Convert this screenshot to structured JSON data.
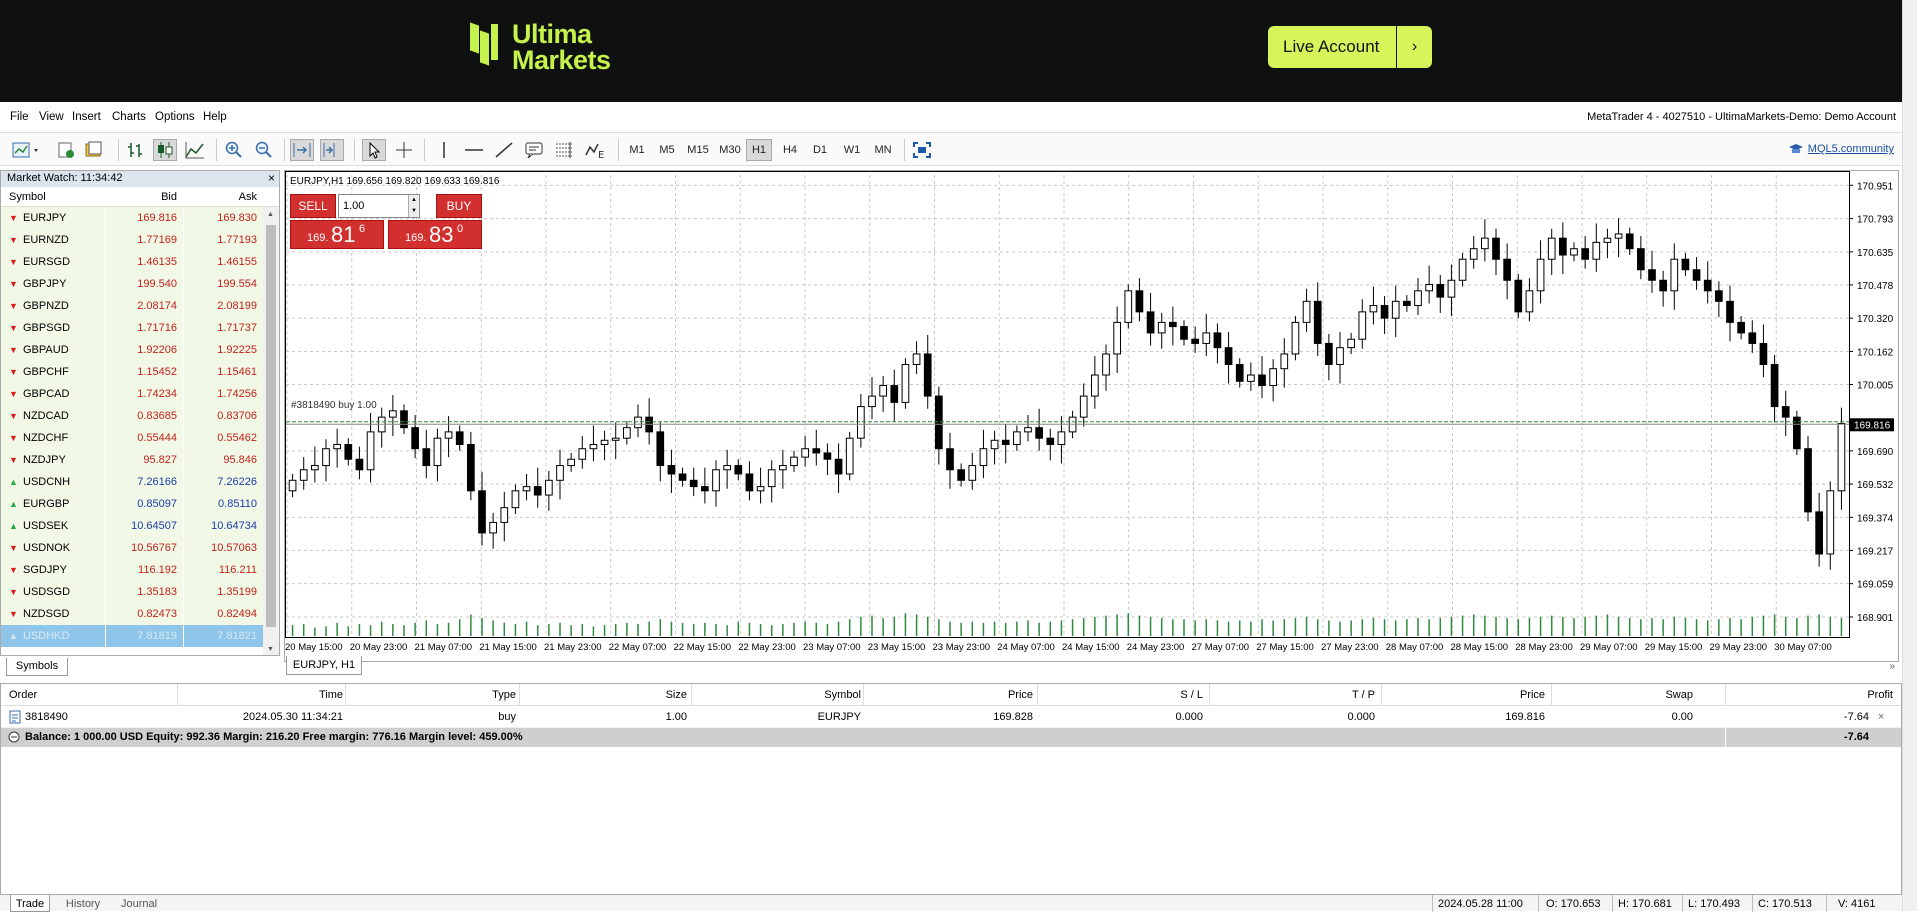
{
  "banner": {
    "logo_line1": "Ultima",
    "logo_line2": "Markets",
    "live_button": "Live Account",
    "live_arrow": "›",
    "colors": {
      "background": "#0e110f",
      "accent": "#c5f24c"
    }
  },
  "menu": {
    "items": [
      "File",
      "View",
      "Insert",
      "Charts",
      "Options",
      "Help"
    ],
    "window_title": "MetaTrader 4 - 4027510 - UltimaMarkets-Demo: Demo Account"
  },
  "toolbar": {
    "timeframes": [
      "M1",
      "M5",
      "M15",
      "M30",
      "H1",
      "H4",
      "D1",
      "W1",
      "MN"
    ],
    "selected_timeframe": "H1",
    "mql_link": "MQL5.community"
  },
  "market_watch": {
    "title": "Market Watch: 11:34:42",
    "close": "×",
    "columns": {
      "symbol": "Symbol",
      "bid": "Bid",
      "ask": "Ask"
    },
    "rows": [
      {
        "symbol": "EURJPY",
        "bid": "169.816",
        "ask": "169.830",
        "dir": "down"
      },
      {
        "symbol": "EURNZD",
        "bid": "1.77169",
        "ask": "1.77193",
        "dir": "down"
      },
      {
        "symbol": "EURSGD",
        "bid": "1.46135",
        "ask": "1.46155",
        "dir": "down"
      },
      {
        "symbol": "GBPJPY",
        "bid": "199.540",
        "ask": "199.554",
        "dir": "down"
      },
      {
        "symbol": "GBPNZD",
        "bid": "2.08174",
        "ask": "2.08199",
        "dir": "down"
      },
      {
        "symbol": "GBPSGD",
        "bid": "1.71716",
        "ask": "1.71737",
        "dir": "down"
      },
      {
        "symbol": "GBPAUD",
        "bid": "1.92206",
        "ask": "1.92225",
        "dir": "down"
      },
      {
        "symbol": "GBPCHF",
        "bid": "1.15452",
        "ask": "1.15461",
        "dir": "down"
      },
      {
        "symbol": "GBPCAD",
        "bid": "1.74234",
        "ask": "1.74256",
        "dir": "down"
      },
      {
        "symbol": "NZDCAD",
        "bid": "0.83685",
        "ask": "0.83706",
        "dir": "down"
      },
      {
        "symbol": "NZDCHF",
        "bid": "0.55444",
        "ask": "0.55462",
        "dir": "down"
      },
      {
        "symbol": "NZDJPY",
        "bid": "95.827",
        "ask": "95.846",
        "dir": "down"
      },
      {
        "symbol": "USDCNH",
        "bid": "7.26166",
        "ask": "7.26226",
        "dir": "up"
      },
      {
        "symbol": "EURGBP",
        "bid": "0.85097",
        "ask": "0.85110",
        "dir": "up"
      },
      {
        "symbol": "USDSEK",
        "bid": "10.64507",
        "ask": "10.64734",
        "dir": "up"
      },
      {
        "symbol": "USDNOK",
        "bid": "10.56767",
        "ask": "10.57063",
        "dir": "down"
      },
      {
        "symbol": "SGDJPY",
        "bid": "116.192",
        "ask": "116.211",
        "dir": "down"
      },
      {
        "symbol": "USDSGD",
        "bid": "1.35183",
        "ask": "1.35199",
        "dir": "down"
      },
      {
        "symbol": "NZDSGD",
        "bid": "0.82473",
        "ask": "0.82494",
        "dir": "down"
      },
      {
        "symbol": "USDHKD",
        "bid": "7.81819",
        "ask": "7.81821",
        "dir": "up",
        "selected": true
      }
    ],
    "tab": "Symbols",
    "colors": {
      "down": "#c0221c",
      "up": "#1a3ca8",
      "arrow_up": "#2aa84a",
      "arrow_down": "#d62020"
    }
  },
  "chart": {
    "header": "EURJPY,H1  169.656 169.820 169.633 169.816",
    "sell_label": "SELL",
    "buy_label": "BUY",
    "lot": "1.00",
    "sell_price": {
      "prefix": "169.",
      "big": "81",
      "sup": "6"
    },
    "buy_price": {
      "prefix": "169.",
      "big": "83",
      "sup": "0"
    },
    "order_line_label": "#3818490 buy 1.00",
    "current_price_label": "169.816",
    "tab": "EURJPY, H1",
    "expander": "»"
  },
  "chart_data": {
    "type": "candlestick",
    "symbol": "EURJPY",
    "timeframe": "H1",
    "y_ticks": [
      "170.951",
      "170.793",
      "170.635",
      "170.478",
      "170.320",
      "170.162",
      "170.005",
      "169.690",
      "169.532",
      "169.374",
      "169.217",
      "169.059",
      "168.901"
    ],
    "ylim": [
      168.82,
      171.0
    ],
    "x_ticks": [
      "20 May 15:00",
      "20 May 23:00",
      "21 May 07:00",
      "21 May 15:00",
      "21 May 23:00",
      "22 May 07:00",
      "22 May 15:00",
      "22 May 23:00",
      "23 May 07:00",
      "23 May 15:00",
      "23 May 23:00",
      "24 May 07:00",
      "24 May 15:00",
      "24 May 23:00",
      "27 May 07:00",
      "27 May 15:00",
      "27 May 23:00",
      "28 May 07:00",
      "28 May 15:00",
      "28 May 23:00",
      "29 May 07:00",
      "29 May 15:00",
      "29 May 23:00",
      "30 May 07:00"
    ],
    "current_price": 169.816,
    "order_price": 169.828,
    "close_series": [
      169.55,
      169.6,
      169.62,
      169.7,
      169.72,
      169.65,
      169.6,
      169.78,
      169.85,
      169.88,
      169.8,
      169.7,
      169.62,
      169.75,
      169.78,
      169.72,
      169.5,
      169.3,
      169.35,
      169.42,
      169.5,
      169.52,
      169.48,
      169.55,
      169.62,
      169.65,
      169.7,
      169.72,
      169.74,
      169.75,
      169.8,
      169.85,
      169.78,
      169.62,
      169.58,
      169.55,
      169.52,
      169.5,
      169.6,
      169.62,
      169.58,
      169.5,
      169.52,
      169.6,
      169.62,
      169.66,
      169.7,
      169.68,
      169.65,
      169.58,
      169.75,
      169.9,
      169.95,
      170.0,
      169.92,
      170.1,
      170.15,
      169.95,
      169.7,
      169.6,
      169.55,
      169.62,
      169.7,
      169.74,
      169.72,
      169.78,
      169.8,
      169.75,
      169.72,
      169.78,
      169.85,
      169.95,
      170.05,
      170.15,
      170.3,
      170.45,
      170.35,
      170.25,
      170.3,
      170.28,
      170.22,
      170.2,
      170.25,
      170.18,
      170.1,
      170.02,
      170.05,
      170.0,
      170.08,
      170.15,
      170.3,
      170.4,
      170.2,
      170.1,
      170.18,
      170.22,
      170.35,
      170.38,
      170.32,
      170.4,
      170.38,
      170.45,
      170.48,
      170.42,
      170.5,
      170.6,
      170.65,
      170.7,
      170.6,
      170.5,
      170.35,
      170.45,
      170.6,
      170.7,
      170.62,
      170.65,
      170.6,
      170.68,
      170.7,
      170.72,
      170.65,
      170.55,
      170.5,
      170.45,
      170.6,
      170.55,
      170.5,
      170.45,
      170.4,
      170.3,
      170.25,
      170.2,
      170.1,
      169.9,
      169.85,
      169.7,
      169.4,
      169.2,
      169.5,
      169.82
    ],
    "volume_series": [
      0.45,
      0.5,
      0.35,
      0.4,
      0.55,
      0.4,
      0.5,
      0.45,
      0.6,
      0.5,
      0.45,
      0.55,
      0.65,
      0.5,
      0.55,
      0.7,
      0.9,
      0.75,
      0.65,
      0.55,
      0.5,
      0.6,
      0.45,
      0.5,
      0.55,
      0.45,
      0.5,
      0.4,
      0.45,
      0.5,
      0.55,
      0.5,
      0.6,
      0.7,
      0.6,
      0.55,
      0.5,
      0.55,
      0.5,
      0.45,
      0.6,
      0.55,
      0.5,
      0.45,
      0.5,
      0.55,
      0.6,
      0.55,
      0.5,
      0.6,
      0.7,
      0.8,
      0.85,
      0.75,
      0.8,
      0.95,
      0.9,
      0.8,
      0.7,
      0.6,
      0.55,
      0.6,
      0.55,
      0.6,
      0.55,
      0.6,
      0.65,
      0.55,
      0.6,
      0.65,
      0.7,
      0.75,
      0.8,
      0.85,
      0.9,
      0.95,
      0.85,
      0.8,
      0.75,
      0.7,
      0.7,
      0.65,
      0.7,
      0.65,
      0.6,
      0.65,
      0.6,
      0.7,
      0.65,
      0.7,
      0.75,
      0.8,
      0.7,
      0.65,
      0.6,
      0.65,
      0.7,
      0.75,
      0.7,
      0.65,
      0.7,
      0.75,
      0.7,
      0.75,
      0.8,
      0.85,
      0.9,
      0.85,
      0.8,
      0.75,
      0.7,
      0.75,
      0.8,
      0.85,
      0.8,
      0.75,
      0.8,
      0.85,
      0.9,
      0.8,
      0.75,
      0.7,
      0.75,
      0.7,
      0.8,
      0.75,
      0.7,
      0.65,
      0.7,
      0.75,
      0.7,
      0.8,
      0.85,
      0.9,
      0.8,
      0.75,
      0.85,
      0.9,
      0.8,
      0.75
    ],
    "colors": {
      "bull": "#ffffff",
      "bear": "#000000",
      "volume": "#2e8b3d",
      "grid": "#c8c8c8",
      "current_price_bg": "#000000"
    }
  },
  "orders": {
    "columns": [
      "Order",
      "Time",
      "Type",
      "Size",
      "Symbol",
      "Price",
      "S / L",
      "T / P",
      "Price",
      "Swap",
      "Profit"
    ],
    "rows": [
      {
        "order": "3818490",
        "time": "2024.05.30 11:34:21",
        "type": "buy",
        "size": "1.00",
        "symbol": "EURJPY",
        "price": "169.828",
        "sl": "0.000",
        "tp": "0.000",
        "cur_price": "169.816",
        "swap": "0.00",
        "profit": "-7.64",
        "close": "×"
      }
    ],
    "balance_text": "Balance: 1 000.00 USD  Equity: 992.36  Margin: 216.20  Free margin: 776.16  Margin level: 459.00%",
    "balance_profit": "-7.64"
  },
  "bottom_tabs": [
    "Trade",
    "History",
    "Journal"
  ],
  "status_bar": {
    "date": "2024.05.28 11:00",
    "open": "O: 170.653",
    "high": "H: 170.681",
    "low": "L: 170.493",
    "close": "C: 170.513",
    "volume": "V: 4161"
  }
}
